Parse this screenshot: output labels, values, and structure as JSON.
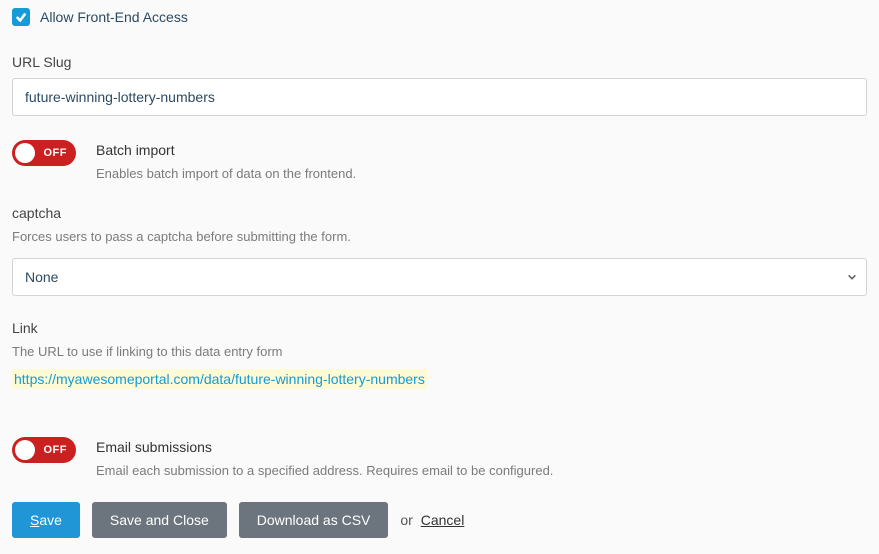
{
  "allowFrontend": {
    "label": "Allow Front-End Access",
    "checked": true
  },
  "urlSlug": {
    "label": "URL Slug",
    "value": "future-winning-lottery-numbers"
  },
  "batchImport": {
    "title": "Batch import",
    "description": "Enables batch import of data on the frontend.",
    "state": "OFF"
  },
  "captcha": {
    "label": "captcha",
    "hint": "Forces users to pass a captcha before submitting the form.",
    "selected": "None"
  },
  "link": {
    "label": "Link",
    "hint": "The URL to use if linking to this data entry form",
    "value": "https://myawesomeportal.com/data/future-winning-lottery-numbers"
  },
  "emailSubmissions": {
    "title": "Email submissions",
    "description": "Email each submission to a specified address. Requires email to be configured.",
    "state": "OFF"
  },
  "buttons": {
    "save": "Save",
    "saveClose": "Save and Close",
    "downloadCsv": "Download as CSV",
    "or": "or",
    "cancel": "Cancel"
  }
}
